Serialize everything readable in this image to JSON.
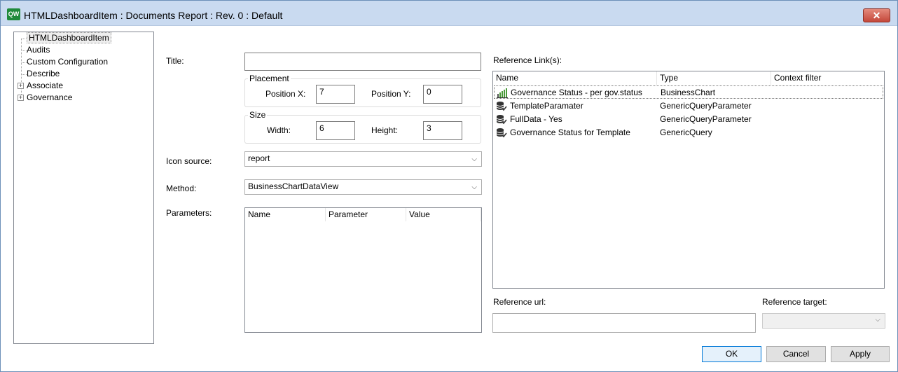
{
  "window": {
    "app_icon": "QW",
    "title": "HTMLDashboardItem : Documents Report : Rev. 0  : Default",
    "close_label": "✕"
  },
  "tree": {
    "items": [
      {
        "label": "HTMLDashboardItem",
        "selected": true,
        "expandable": false
      },
      {
        "label": "Audits",
        "expandable": false
      },
      {
        "label": "Custom Configuration",
        "expandable": false
      },
      {
        "label": "Describe",
        "expandable": false
      },
      {
        "label": "Associate",
        "expandable": true
      },
      {
        "label": "Governance",
        "expandable": true
      }
    ]
  },
  "form": {
    "title_label": "Title:",
    "title_value": "",
    "placement": {
      "legend": "Placement",
      "pos_x_label": "Position X:",
      "pos_x_value": "7",
      "pos_y_label": "Position Y:",
      "pos_y_value": "0"
    },
    "size": {
      "legend": "Size",
      "width_label": "Width:",
      "width_value": "6",
      "height_label": "Height:",
      "height_value": "3"
    },
    "icon_source_label": "Icon source:",
    "icon_source_value": "report",
    "method_label": "Method:",
    "method_value": "BusinessChartDataView",
    "parameters_label": "Parameters:",
    "parameters_columns": [
      "Name",
      "Parameter",
      "Value"
    ]
  },
  "reference": {
    "links_label": "Reference Link(s):",
    "columns": [
      "Name",
      "Type",
      "Context filter"
    ],
    "rows": [
      {
        "icon": "bar-chart-icon",
        "name": "Governance Status - per gov.status",
        "type": "BusinessChart",
        "context": ""
      },
      {
        "icon": "database-query-icon",
        "name": "TemplateParamater",
        "type": "GenericQueryParameter",
        "context": ""
      },
      {
        "icon": "database-query-icon",
        "name": "FullData - Yes",
        "type": "GenericQueryParameter",
        "context": ""
      },
      {
        "icon": "database-query-icon",
        "name": "Governance Status for Template",
        "type": "GenericQuery",
        "context": ""
      }
    ],
    "url_label": "Reference url:",
    "url_value": "",
    "target_label": "Reference target:",
    "target_value": ""
  },
  "buttons": {
    "ok": "OK",
    "cancel": "Cancel",
    "apply": "Apply"
  }
}
